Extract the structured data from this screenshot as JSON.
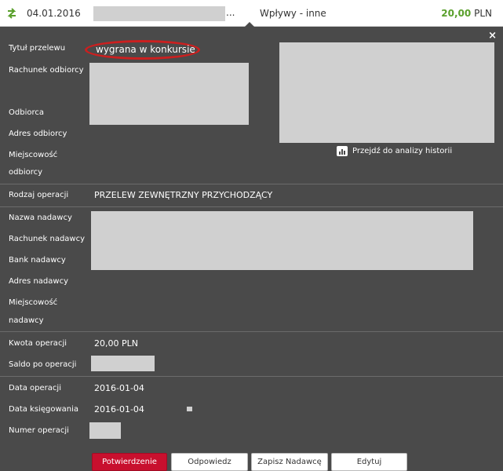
{
  "top": {
    "date": "04.01.2016",
    "ellipsis": "...",
    "category": "Wpływy - inne",
    "amount_value": "20,00",
    "amount_currency": "PLN"
  },
  "panel": {
    "close": "×",
    "title_label": "Tytuł przelewu",
    "title_value": "wygrana w konkursie",
    "recipient_account_label": "Rachunek odbiorcy",
    "recipient_label": "Odbiorca",
    "recipient_address_label": "Adres odbiorcy",
    "recipient_city_label_1": "Miejscowość",
    "recipient_city_label_2": "odbiorcy",
    "history_link": "Przejdź do analizy historii",
    "operation_type_label": "Rodzaj operacji",
    "operation_type_value": "PRZELEW ZEWNĘTRZNY PRZYCHODZĄCY",
    "sender_name_label": "Nazwa nadawcy",
    "sender_account_label": "Rachunek nadawcy",
    "sender_bank_label": "Bank nadawcy",
    "sender_address_label": "Adres nadawcy",
    "sender_city_label_1": "Miejscowość",
    "sender_city_label_2": "nadawcy",
    "amount_label": "Kwota operacji",
    "amount_value": "20,00 PLN",
    "balance_label": "Saldo po operacji",
    "operation_date_label": "Data operacji",
    "operation_date_value": "2016-01-04",
    "posting_date_label": "Data księgowania",
    "posting_date_value": "2016-01-04",
    "operation_number_label": "Numer operacji"
  },
  "buttons": {
    "confirm": "Potwierdzenie",
    "reply": "Odpowiedz",
    "save_sender": "Zapisz Nadawcę",
    "edit": "Edytuj"
  },
  "colors": {
    "panel_bg": "#4a4a4a",
    "accent_red": "#c8102e",
    "amount_green": "#5aa02c"
  }
}
